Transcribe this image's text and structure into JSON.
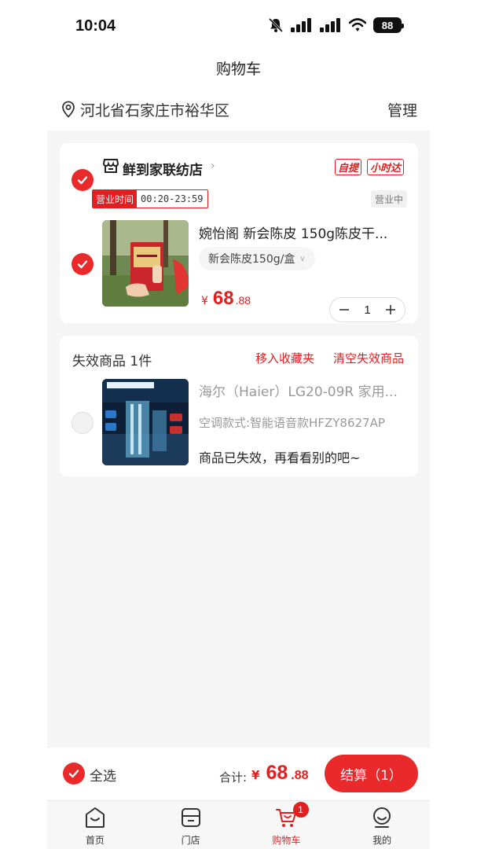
{
  "status_bar": {
    "time": "10:04",
    "battery": "88"
  },
  "header": {
    "title": "购物车"
  },
  "address": {
    "text": "河北省石家庄市裕华区",
    "manage_label": "管理"
  },
  "store": {
    "name": "鲜到家联纺店",
    "badges": [
      "自提",
      "小时达"
    ],
    "hours_label": "营业时间",
    "hours_value": "00:20-23:59",
    "open_status": "营业中",
    "product": {
      "name": "婉怡阁 新会陈皮 150g陈皮干...",
      "spec": "新会陈皮150g/盒",
      "price_currency": "¥",
      "price_int": "68",
      "price_dec": ".88",
      "quantity": "1"
    }
  },
  "invalid_section": {
    "title": "失效商品 1件",
    "move_to_favorites": "移入收藏夹",
    "clear_invalid": "清空失效商品",
    "product": {
      "name": "海尔（Haier）LG20-09R 家用...",
      "spec": "空调款式:智能语音款HFZY8627AP",
      "message": "商品已失效，再看看别的吧~"
    }
  },
  "bottom_bar": {
    "select_all": "全选",
    "total_label": "合计:",
    "total_currency": "¥",
    "total_int": "68",
    "total_dec": ".88",
    "checkout_label": "结算（1）"
  },
  "tab_bar": {
    "items": [
      {
        "label": "首页",
        "icon": "home-icon"
      },
      {
        "label": "门店",
        "icon": "store-icon"
      },
      {
        "label": "购物车",
        "icon": "cart-icon"
      },
      {
        "label": "我的",
        "icon": "profile-icon"
      }
    ],
    "cart_badge": "1"
  },
  "colors": {
    "accent": "#e02020",
    "background": "#f5f5f5"
  }
}
